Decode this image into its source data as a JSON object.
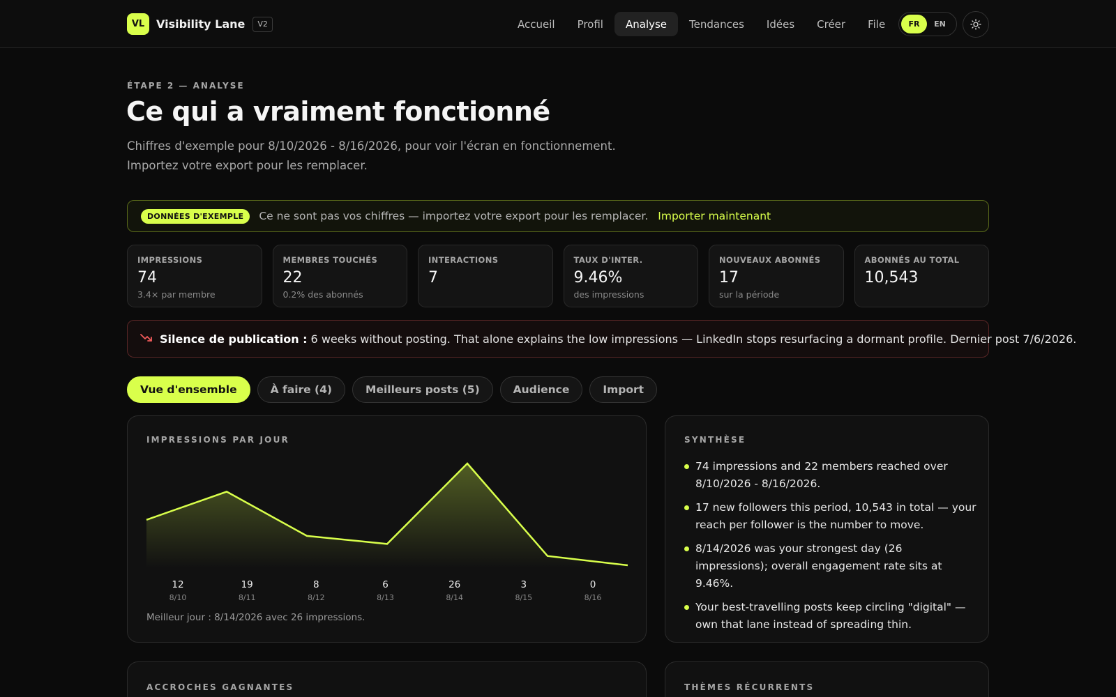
{
  "brand": {
    "logo": "VL",
    "name": "Visibility Lane",
    "version": "V2"
  },
  "nav": {
    "items": [
      "Accueil",
      "Profil",
      "Analyse",
      "Tendances",
      "Idées",
      "Créer",
      "File"
    ],
    "active": "Analyse"
  },
  "lang": {
    "fr": "FR",
    "en": "EN",
    "active": "FR"
  },
  "header": {
    "eyebrow": "ÉTAPE 2 — ANALYSE",
    "title": "Ce qui a vraiment fonctionné",
    "subtitle": "Chiffres d'exemple pour 8/10/2026 - 8/16/2026, pour voir l'écran en fonctionnement. Importez votre export pour les remplacer."
  },
  "banner": {
    "badge": "DONNÉES D'EXEMPLE",
    "text": "Ce ne sont pas vos chiffres — importez votre export pour les remplacer.",
    "link": "Importer maintenant"
  },
  "stats": [
    {
      "label": "IMPRESSIONS",
      "value": "74",
      "sub": "3.4× par membre"
    },
    {
      "label": "MEMBRES TOUCHÉS",
      "value": "22",
      "sub": "0.2% des abonnés"
    },
    {
      "label": "INTERACTIONS",
      "value": "7",
      "sub": ""
    },
    {
      "label": "TAUX D'INTER.",
      "value": "9.46%",
      "sub": "des impressions"
    },
    {
      "label": "NOUVEAUX ABONNÉS",
      "value": "17",
      "sub": "sur la période"
    },
    {
      "label": "ABONNÉS AU TOTAL",
      "value": "10,543",
      "sub": ""
    }
  ],
  "alert": {
    "title": "Silence de publication :",
    "text": "6 weeks without posting. That alone explains the low impressions — LinkedIn stops resurfacing a dormant profile. Dernier post 7/6/2026.",
    "color": "#f05a5a"
  },
  "tabs": [
    "Vue d'ensemble",
    "À faire (4)",
    "Meilleurs posts (5)",
    "Audience",
    "Import"
  ],
  "chart_card": {
    "title": "IMPRESSIONS PAR JOUR",
    "best_day": "Meilleur jour : 8/14/2026 avec 26 impressions."
  },
  "chart_data": {
    "type": "area",
    "categories": [
      "8/10",
      "8/11",
      "8/12",
      "8/13",
      "8/14",
      "8/15",
      "8/16"
    ],
    "values": [
      12,
      19,
      8,
      6,
      26,
      3,
      0
    ],
    "color": "#d9ff4b"
  },
  "summary": {
    "title": "SYNTHÈSE",
    "items": [
      "74 impressions and 22 members reached over 8/10/2026 - 8/16/2026.",
      "17 new followers this period, 10,543 in total — your reach per follower is the number to move.",
      "8/14/2026 was your strongest day (26 impressions); overall engagement rate sits at 9.46%.",
      "Your best-travelling posts keep circling \"digital\" — own that lane instead of spreading thin."
    ]
  },
  "hooks": {
    "title": "ACCROCHES GAGNANTES"
  },
  "themes": {
    "title": "THÈMES RÉCURRENTS"
  },
  "colors": {
    "accent": "#d9ff4b",
    "background": "#0b0b0b",
    "alert": "#f05a5a"
  },
  "icons": {
    "theme_toggle": "sun-icon",
    "alert": "trend-down-icon"
  }
}
